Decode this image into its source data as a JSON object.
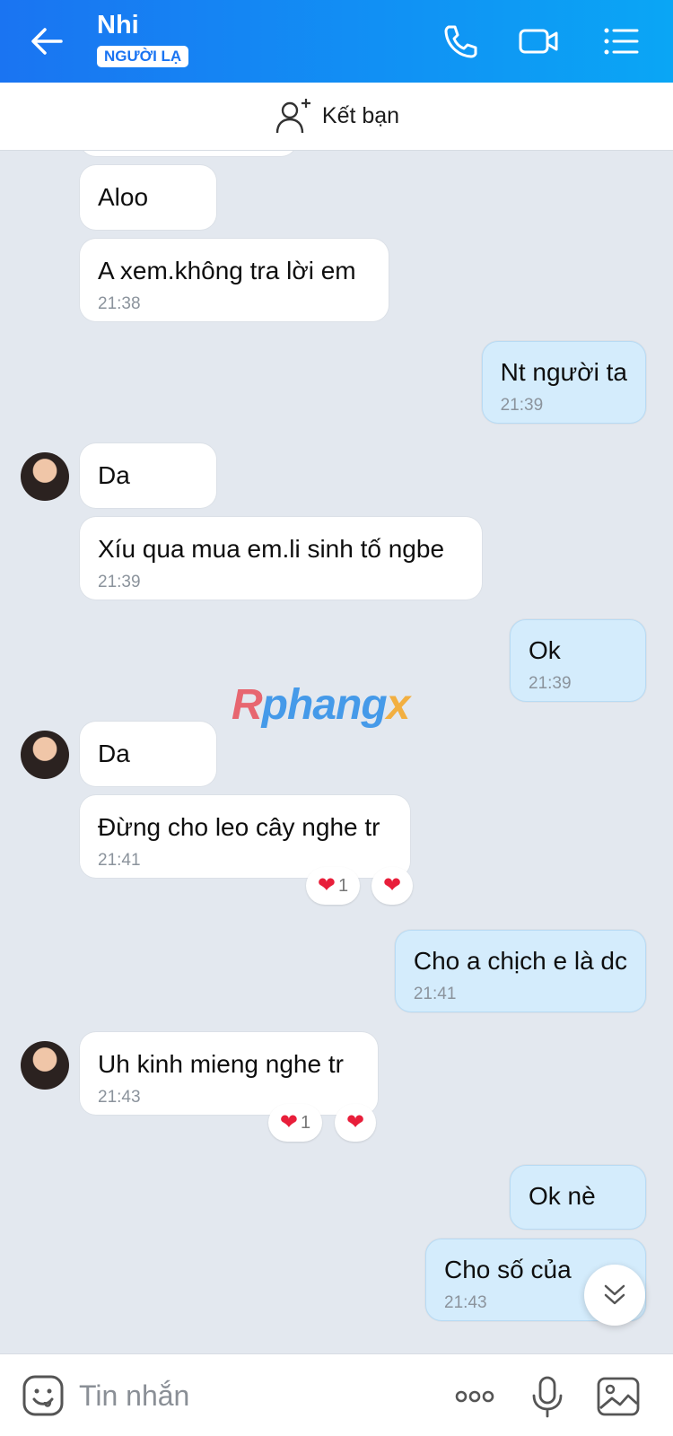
{
  "header": {
    "contact_name": "Nhi",
    "badge": "NGƯỜI LẠ",
    "gradient_start": "#1a74f2",
    "gradient_end": "#0aa6f5"
  },
  "add_friend": {
    "label": "Kết bạn"
  },
  "messages": [
    {
      "dir": "in",
      "text": "Aloo",
      "time": ""
    },
    {
      "dir": "in",
      "text": "A xem.không tra lời em",
      "time": "21:38"
    },
    {
      "dir": "out",
      "text": "Nt người ta",
      "time": "21:39"
    },
    {
      "dir": "in",
      "text": "Da",
      "time": ""
    },
    {
      "dir": "in",
      "text": "Xíu qua mua em.li sinh tố ngbe",
      "time": "21:39"
    },
    {
      "dir": "out",
      "text": "Ok",
      "time": "21:39"
    },
    {
      "dir": "in",
      "text": "Da",
      "time": ""
    },
    {
      "dir": "in",
      "text": "Đừng cho leo cây nghe tr",
      "time": "21:41"
    },
    {
      "dir": "out",
      "text": "Cho a chịch e là dc",
      "time": "21:41"
    },
    {
      "dir": "in",
      "text": "Uh kinh mieng nghe tr",
      "time": "21:43"
    },
    {
      "dir": "out",
      "text": "Ok nè",
      "time": ""
    },
    {
      "dir": "out",
      "text": "Cho số của",
      "time": "21:43"
    }
  ],
  "reactions": [
    {
      "message": 7,
      "count": "1"
    },
    {
      "message": 9,
      "count": "1"
    }
  ],
  "watermark": {
    "part1": "R",
    "part2": "phang",
    "part3": "x"
  },
  "composer": {
    "placeholder": "Tin nhắn"
  },
  "colors": {
    "outgoing_bubble": "#d4ecfc",
    "incoming_bubble": "#ffffff",
    "background": "#e3e8ef",
    "heart": "#e81e3a"
  }
}
